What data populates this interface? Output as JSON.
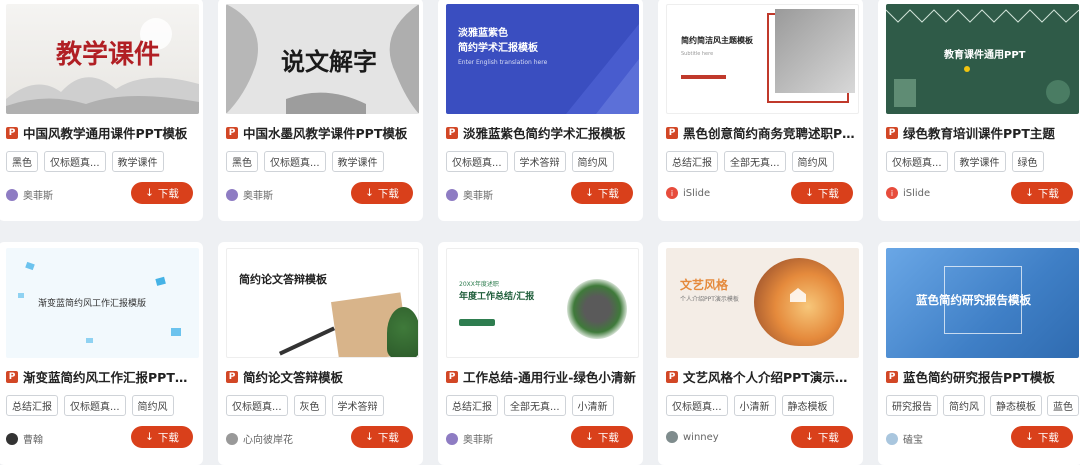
{
  "download_label": "下载",
  "cards": [
    {
      "title": "中国风教学通用课件PPT模板",
      "tags": [
        "黑色",
        "仅标题真...",
        "教学课件"
      ],
      "author": "奥菲斯",
      "thumb_text": "教学课件",
      "thumb_sub": "",
      "colors": {
        "bg": "#f3f1ee",
        "accent": "#c0392b"
      }
    },
    {
      "title": "中国水墨风教学课件PPT模板",
      "tags": [
        "黑色",
        "仅标题真...",
        "教学课件"
      ],
      "author": "奥菲斯",
      "thumb_text": "说文解字",
      "thumb_sub": "",
      "colors": {
        "bg": "#e6e6e6",
        "accent": "#222222"
      }
    },
    {
      "title": "淡雅蓝紫色简约学术汇报模板",
      "tags": [
        "仅标题真...",
        "学术答辩",
        "简约风"
      ],
      "author": "奥菲斯",
      "thumb_text": "淡雅蓝紫色\n简约学术汇报模板",
      "thumb_sub": "Enter English translation here",
      "colors": {
        "bg": "#3a4ec0",
        "accent": "#ffffff"
      }
    },
    {
      "title": "黑色创意简约商务竞聘述职PPT...",
      "tags": [
        "总结汇报",
        "全部无真...",
        "简约风"
      ],
      "author": "iSlide",
      "thumb_text": "简约简洁风主题模板",
      "thumb_sub": "Subtitle here",
      "colors": {
        "bg": "#ffffff",
        "accent": "#c0392b"
      }
    },
    {
      "title": "绿色教育培训课件PPT主题",
      "tags": [
        "仅标题真...",
        "教学课件",
        "绿色"
      ],
      "author": "iSlide",
      "thumb_text": "教育课件通用PPT",
      "thumb_sub": "",
      "colors": {
        "bg": "#2f5b48",
        "accent": "#f1c40f"
      }
    },
    {
      "title": "渐变蓝简约风工作汇报PPT模版",
      "tags": [
        "总结汇报",
        "仅标题真...",
        "简约风"
      ],
      "author": "曹翰",
      "thumb_text": "渐变蓝简约风工作汇报模版",
      "thumb_sub": "",
      "colors": {
        "bg": "#f2f9fd",
        "accent": "#46b3e6"
      }
    },
    {
      "title": "简约论文答辩模板",
      "tags": [
        "仅标题真...",
        "灰色",
        "学术答辩"
      ],
      "author": "心向彼岸花",
      "thumb_text": "简约论文答辩模板",
      "thumb_sub": "",
      "colors": {
        "bg": "#ffffff",
        "accent": "#333333"
      }
    },
    {
      "title": "工作总结-通用行业-绿色小清新",
      "tags": [
        "总结汇报",
        "全部无真...",
        "小清新"
      ],
      "author": "奥菲斯",
      "thumb_text": "年度工作总结/汇报",
      "thumb_sub": "20XX年度述职",
      "colors": {
        "bg": "#ffffff",
        "accent": "#2e7d4f"
      }
    },
    {
      "title": "文艺风格个人介绍PPT演示模板",
      "tags": [
        "仅标题真...",
        "小清新",
        "静态模板"
      ],
      "author": "winney",
      "thumb_text": "文艺风格",
      "thumb_sub": "个人介绍PPT演示模板",
      "colors": {
        "bg": "#f4ede6",
        "accent": "#e58a3c"
      }
    },
    {
      "title": "蓝色简约研究报告PPT模板",
      "tags": [
        "研究报告",
        "简约风",
        "静态模板",
        "蓝色"
      ],
      "author": "磕宝",
      "thumb_text": "蓝色简约研究报告模板",
      "thumb_sub": "",
      "colors": {
        "bg": "#4f8fd4",
        "accent": "#ffffff"
      }
    }
  ]
}
